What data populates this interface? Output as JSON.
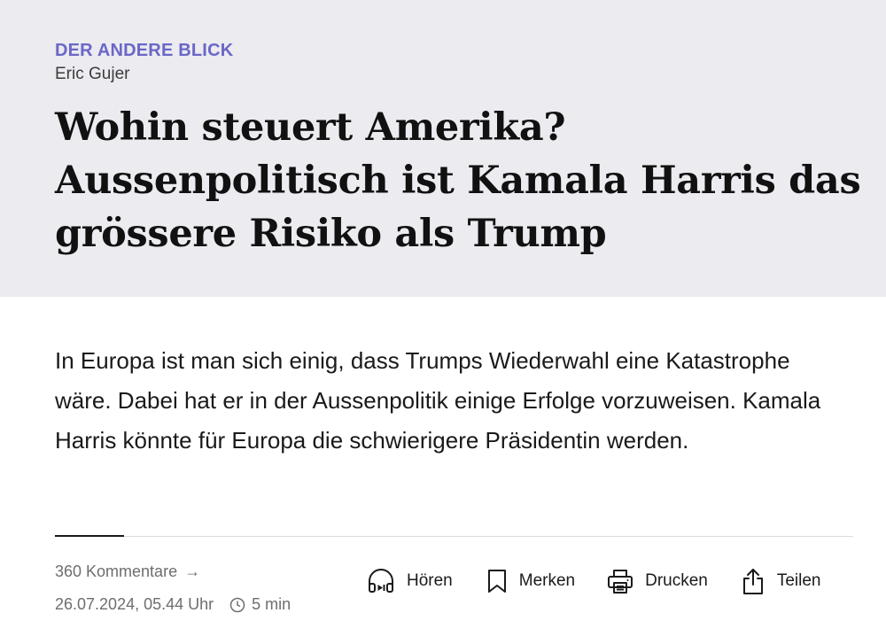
{
  "article": {
    "kicker": "DER ANDERE BLICK",
    "author": "Eric Gujer",
    "headline": "Wohin steuert Amerika? Aussenpolitisch ist Kamala Harris das grössere Risiko als Trump",
    "lead": "In Europa ist man sich einig, dass Trumps Wiederwahl eine Katastrophe wäre. Dabei hat er in der Aussenpolitik einige Erfolge vorzuweisen. Kamala Harris könnte für Europa die schwierigere Präsidentin werden."
  },
  "meta": {
    "comments": "360 Kommentare",
    "comments_arrow": "→",
    "date": "26.07.2024, 05.44 Uhr",
    "reading_time": "5 min"
  },
  "actions": {
    "listen": {
      "label": "Hören",
      "icon": "headphones-icon"
    },
    "bookmark": {
      "label": "Merken",
      "icon": "bookmark-icon"
    },
    "print": {
      "label": "Drucken",
      "icon": "printer-icon"
    },
    "share": {
      "label": "Teilen",
      "icon": "share-icon"
    }
  },
  "colors": {
    "kicker": "#6a67c7",
    "header_background": "#ebebf0",
    "muted_text": "#6e6e6e"
  }
}
